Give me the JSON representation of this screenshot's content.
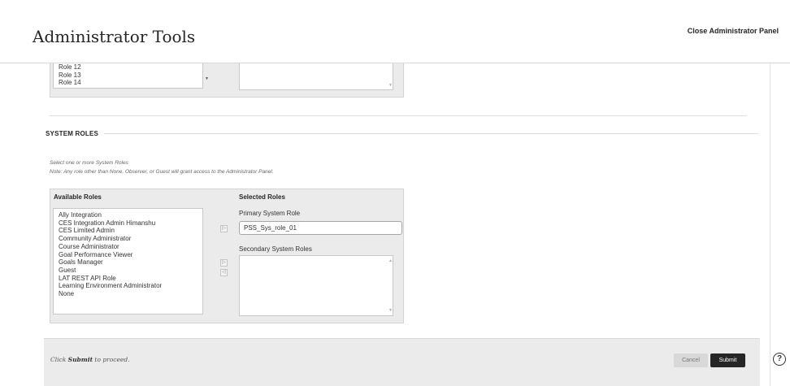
{
  "header": {
    "title": "Administrator Tools",
    "close_label": "Close Administrator Panel"
  },
  "institution_roles": {
    "visible_items": [
      "Role 12",
      "Role 13",
      "Role 14"
    ]
  },
  "system_roles": {
    "section_title": "SYSTEM ROLES",
    "instruction_1": "Select one or more System Roles",
    "instruction_2": "Note: Any role other than None, Observer, or Guest will grant access to the Administrator Panel.",
    "available_heading": "Available Roles",
    "selected_heading": "Selected Roles",
    "available_items": [
      "Ally Integration",
      "CES Integration Admin Himanshu",
      "CES Limited Admin",
      "Community Administrator",
      "Course Administrator",
      "Goal Performance Viewer",
      "Goals Manager",
      "Guest",
      "LAT REST API Role",
      "Learning Environment Administrator",
      "None"
    ],
    "primary_label": "Primary System Role",
    "primary_value": "PSS_Sys_role_01",
    "secondary_label": "Secondary System Roles",
    "move_right_glyph": "▷",
    "move_left_glyph": "◁"
  },
  "footer": {
    "prefix": "Click ",
    "emphasis": "Submit",
    "suffix": " to proceed.",
    "cancel_label": "Cancel",
    "submit_label": "Submit"
  },
  "help_glyph": "?"
}
